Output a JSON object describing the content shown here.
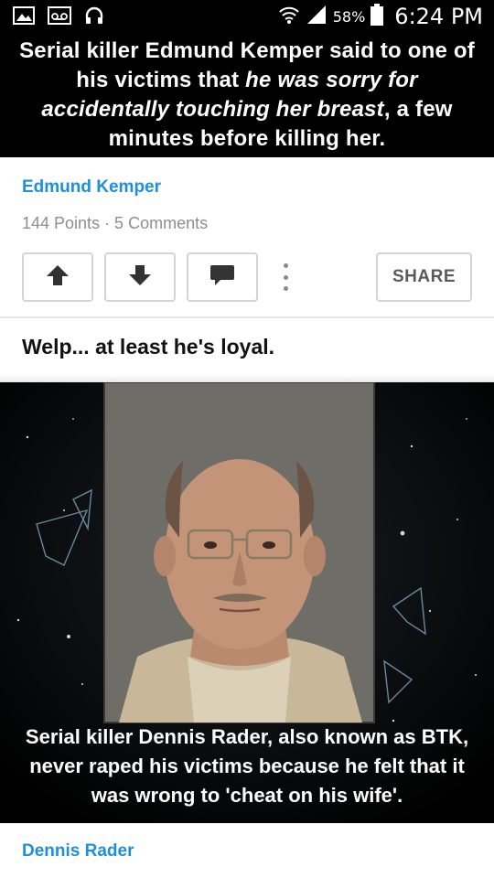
{
  "status_bar": {
    "icons": [
      "image-icon",
      "voicemail-icon",
      "headphones-icon",
      "wifi-icon",
      "signal-icon",
      "battery-icon"
    ],
    "battery": "58%",
    "time": "6:24 PM"
  },
  "post1": {
    "image_caption_part1": "Serial killer Edmund Kemper said to one of his victims that ",
    "image_caption_italic": "he was sorry for accidentally touching her breast",
    "image_caption_part2": ", a few minutes before killing her.",
    "author": "Edmund Kemper",
    "stats": "144 Points · 5 Comments",
    "actions": {
      "upvote_icon": "arrow-up-icon",
      "downvote_icon": "arrow-down-icon",
      "comment_icon": "comment-icon",
      "more_icon": "more-vertical-icon",
      "share_label": "SHARE"
    }
  },
  "post2": {
    "title": "Welp... at least he's loyal.",
    "image_caption": "Serial killer Dennis Rader, also known as BTK, never raped his victims because he felt that it was wrong to 'cheat on his wife'.",
    "author": "Dennis Rader"
  },
  "colors": {
    "accent": "#1d8fdb",
    "muted": "#8e8e8e",
    "border": "#d4d4d4"
  }
}
